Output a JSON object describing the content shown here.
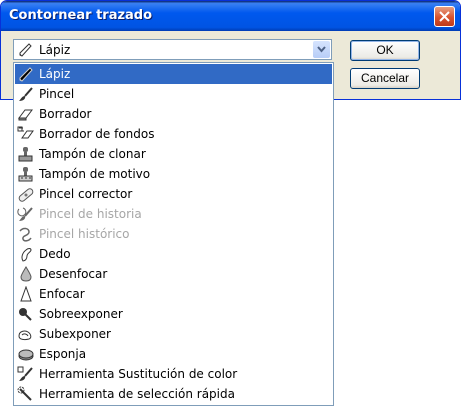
{
  "window": {
    "title": "Contornear trazado"
  },
  "combo": {
    "value": "Lápiz",
    "icon": "pencil-icon"
  },
  "buttons": {
    "ok": "OK",
    "cancel": "Cancelar"
  },
  "list": {
    "selected_index": 0,
    "items": [
      {
        "label": "Lápiz",
        "icon": "pencil-icon",
        "enabled": true
      },
      {
        "label": "Pincel",
        "icon": "brush-icon",
        "enabled": true
      },
      {
        "label": "Borrador",
        "icon": "eraser-icon",
        "enabled": true
      },
      {
        "label": "Borrador de fondos",
        "icon": "background-eraser-icon",
        "enabled": true
      },
      {
        "label": "Tampón de clonar",
        "icon": "clone-stamp-icon",
        "enabled": true
      },
      {
        "label": "Tampón de motivo",
        "icon": "pattern-stamp-icon",
        "enabled": true
      },
      {
        "label": "Pincel corrector",
        "icon": "healing-brush-icon",
        "enabled": true
      },
      {
        "label": "Pincel de historia",
        "icon": "history-brush-icon",
        "enabled": false
      },
      {
        "label": "Pincel histórico",
        "icon": "art-history-brush-icon",
        "enabled": false
      },
      {
        "label": "Dedo",
        "icon": "smudge-icon",
        "enabled": true
      },
      {
        "label": "Desenfocar",
        "icon": "blur-icon",
        "enabled": true
      },
      {
        "label": "Enfocar",
        "icon": "sharpen-icon",
        "enabled": true
      },
      {
        "label": "Sobreexponer",
        "icon": "dodge-icon",
        "enabled": true
      },
      {
        "label": "Subexponer",
        "icon": "burn-icon",
        "enabled": true
      },
      {
        "label": "Esponja",
        "icon": "sponge-icon",
        "enabled": true
      },
      {
        "label": "Herramienta Sustitución de color",
        "icon": "color-replacement-icon",
        "enabled": true
      },
      {
        "label": "Herramienta de selección rápida",
        "icon": "quick-selection-icon",
        "enabled": true
      }
    ]
  },
  "colors": {
    "selection": "#316ac5",
    "titlebar": "#0054e3",
    "dialog_bg": "#ece9d8",
    "disabled_text": "#a6a6a6"
  }
}
